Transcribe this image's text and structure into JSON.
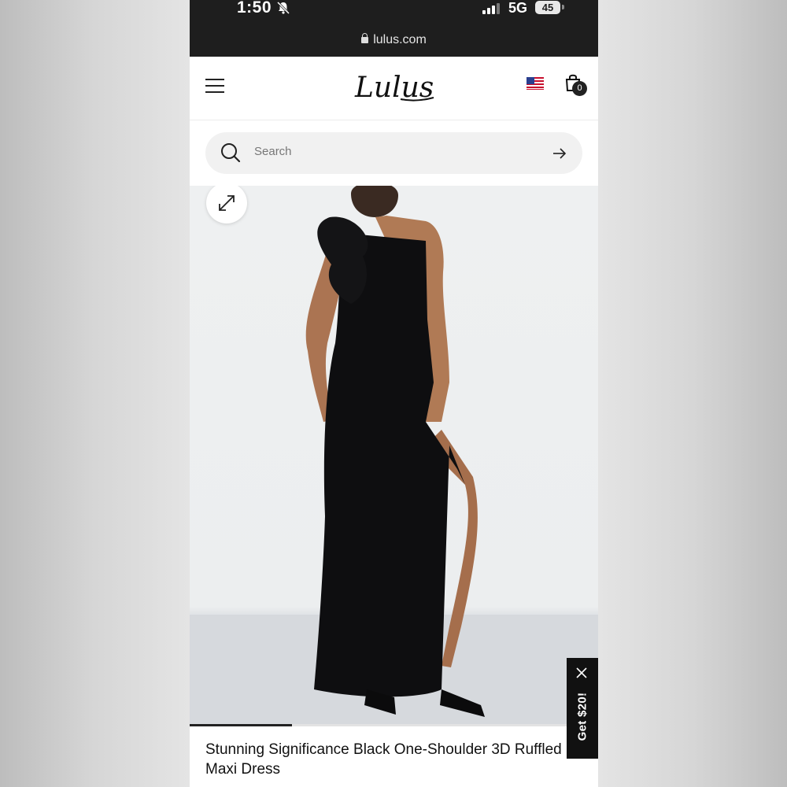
{
  "status_bar": {
    "time": "1:50",
    "network": "5G",
    "battery": "45"
  },
  "browser": {
    "url": "lulus.com"
  },
  "header": {
    "logo_text": "Lulus",
    "cart_count": "0"
  },
  "search": {
    "placeholder": "Search"
  },
  "gallery": {
    "progress": 0.25
  },
  "promo": {
    "label": "Get $20!"
  },
  "product": {
    "title": "Stunning Significance Black One-Shoulder 3D Ruffled Maxi Dress"
  },
  "icons": [
    "bell-slash-icon",
    "signal-icon",
    "lock-icon",
    "menu-icon",
    "us-flag-icon",
    "shopping-bag-icon",
    "search-icon",
    "arrow-right-icon",
    "expand-icon",
    "close-icon"
  ]
}
